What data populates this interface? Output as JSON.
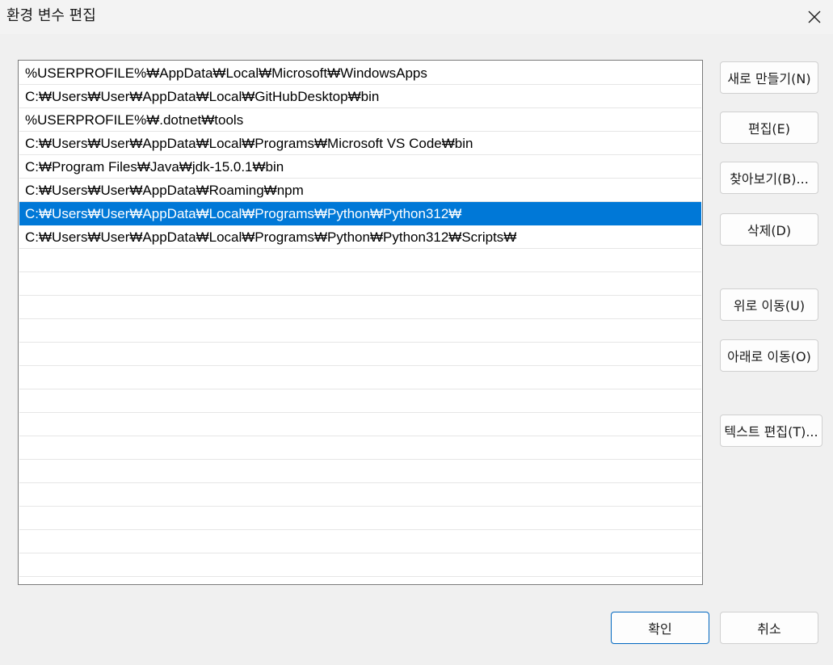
{
  "window": {
    "title": "환경 변수 편집"
  },
  "paths": [
    "%USERPROFILE%₩AppData₩Local₩Microsoft₩WindowsApps",
    "C:₩Users₩User₩AppData₩Local₩GitHubDesktop₩bin",
    "%USERPROFILE%₩.dotnet₩tools",
    "C:₩Users₩User₩AppData₩Local₩Programs₩Microsoft VS Code₩bin",
    "C:₩Program Files₩Java₩jdk-15.0.1₩bin",
    "C:₩Users₩User₩AppData₩Roaming₩npm",
    "C:₩Users₩User₩AppData₩Local₩Programs₩Python₩Python312₩",
    "C:₩Users₩User₩AppData₩Local₩Programs₩Python₩Python312₩Scripts₩"
  ],
  "selected_index": 6,
  "buttons": {
    "new": "새로 만들기(N)",
    "edit": "편집(E)",
    "browse": "찾아보기(B)...",
    "delete": "삭제(D)",
    "move_up": "위로 이동(U)",
    "move_down": "아래로 이동(O)",
    "edit_text": "텍스트 편집(T)...",
    "ok": "확인",
    "cancel": "취소"
  },
  "colors": {
    "selection": "#0078d7",
    "ok_border": "#0067c0"
  },
  "icons": {
    "close": "close-icon"
  }
}
